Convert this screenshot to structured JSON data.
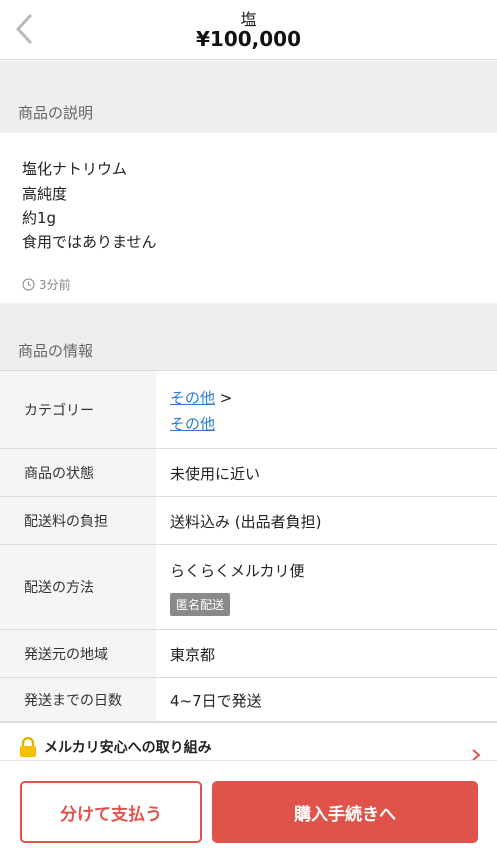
{
  "header": {
    "title": "塩",
    "price": "¥100,000"
  },
  "description": {
    "section_title": "商品の説明",
    "lines": [
      "塩化ナトリウム",
      "高純度",
      "約1g",
      "食用ではありません"
    ],
    "posted_time": "3分前"
  },
  "info": {
    "section_title": "商品の情報",
    "category": {
      "label": "カテゴリー",
      "link1": "その他",
      "separator": ">",
      "link2": "その他"
    },
    "condition": {
      "label": "商品の状態",
      "value": "未使用に近い"
    },
    "shipping_fee": {
      "label": "配送料の負担",
      "value": "送料込み (出品者負担)"
    },
    "shipping_method": {
      "label": "配送の方法",
      "value": "らくらくメルカリ便",
      "badge": "匿名配送"
    },
    "ship_from": {
      "label": "発送元の地域",
      "value": "東京都"
    },
    "ship_days": {
      "label": "発送までの日数",
      "value": "4~7日で発送"
    }
  },
  "safety": {
    "text": "メルカリ安心への取り組み"
  },
  "actions": {
    "split_pay": "分けて支払う",
    "buy": "購入手続きへ"
  },
  "colors": {
    "accent": "#e0534a",
    "link": "#2a7bd1",
    "badge": "#8a8a8a"
  },
  "icons": [
    "chevron-left-icon",
    "clock-icon",
    "lock-icon",
    "chevron-right-icon"
  ]
}
